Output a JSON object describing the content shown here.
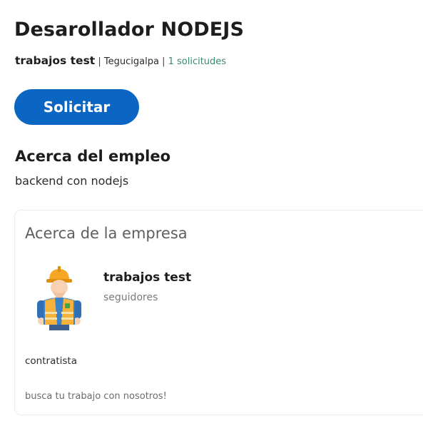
{
  "job": {
    "title": "Desarollador NODEJS",
    "company": "trabajos test",
    "location": "Tegucigalpa",
    "applications": "1 solicitudes",
    "separator": "|"
  },
  "actions": {
    "apply_label": "Solicitar"
  },
  "about_job": {
    "heading": "Acerca del empleo",
    "description": "backend con nodejs"
  },
  "about_company": {
    "heading": "Acerca de la empresa",
    "name": "trabajos test",
    "followers": "seguidores",
    "industry": "contratista",
    "tagline": "busca tu trabajo con nosotros!",
    "avatar_icon": "construction-worker-icon"
  },
  "colors": {
    "primary": "#0a66c2",
    "applications_text": "#3a8a6e"
  }
}
